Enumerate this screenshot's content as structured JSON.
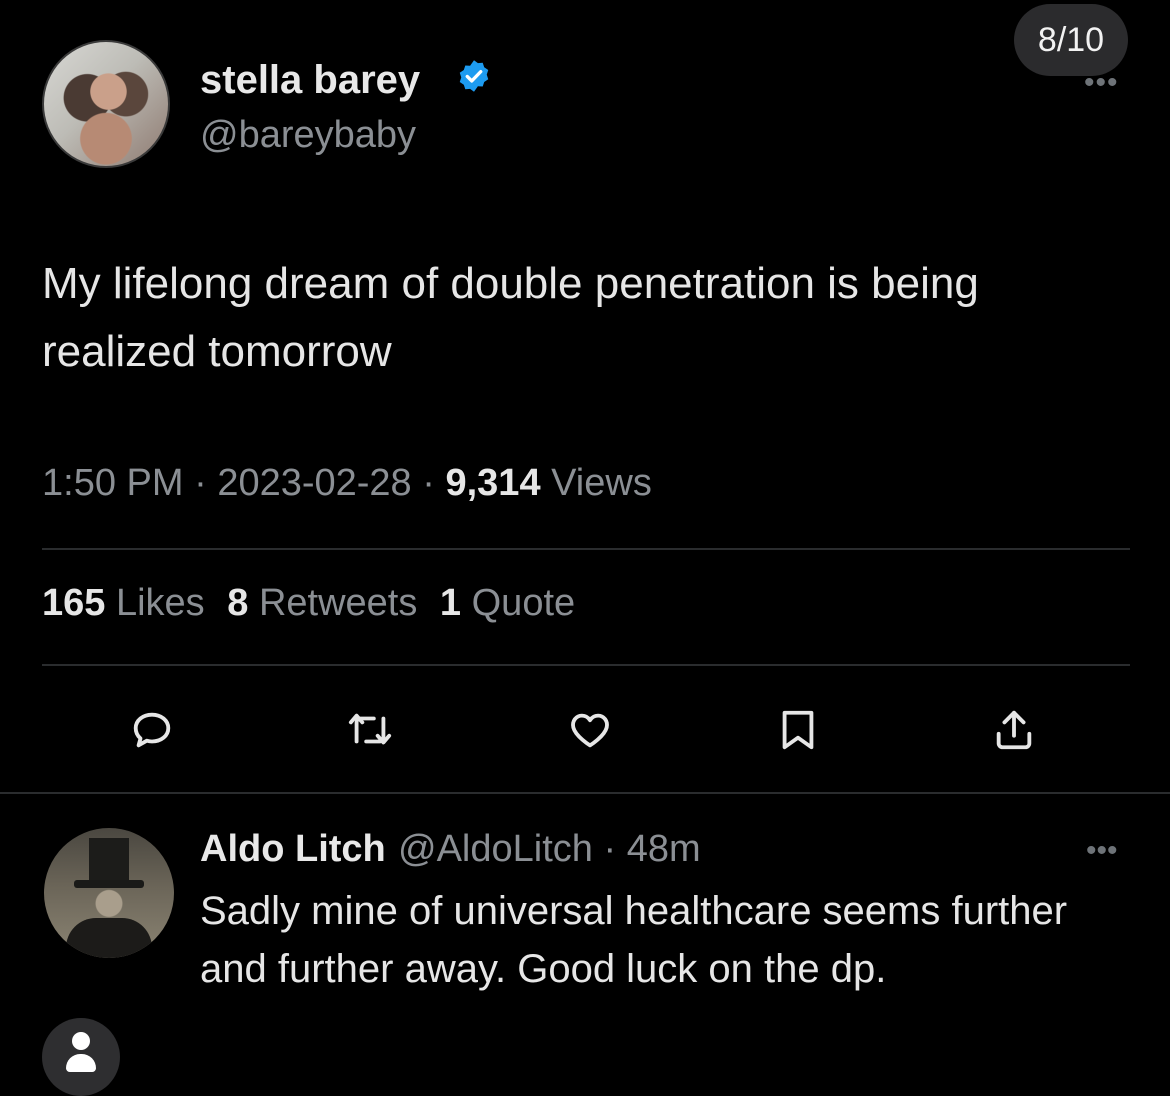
{
  "page_counter": "8/10",
  "tweet": {
    "display_name": "stella barey",
    "handle": "@bareybaby",
    "text": "My lifelong dream of double penetration is being realized tomorrow",
    "time": "1:50 PM",
    "date": "2023-02-28",
    "views_count": "9,314",
    "views_label": "Views",
    "likes_count": "165",
    "likes_label": "Likes",
    "retweets_count": "8",
    "retweets_label": "Retweets",
    "quotes_count": "1",
    "quotes_label": "Quote",
    "verified_color": "#1d9bf0"
  },
  "actions": [
    "reply-icon",
    "retweet-icon",
    "like-icon",
    "bookmark-icon",
    "share-icon"
  ],
  "reply": {
    "display_name": "Aldo Litch",
    "handle": "@AldoLitch",
    "time": "48m",
    "text": "Sadly mine of universal healthcare seems further and further away. Good luck on the dp."
  },
  "colors": {
    "background": "#000000",
    "text": "#e6e6e6",
    "secondary_text": "#8b8f94",
    "divider": "#2a2c2e"
  }
}
